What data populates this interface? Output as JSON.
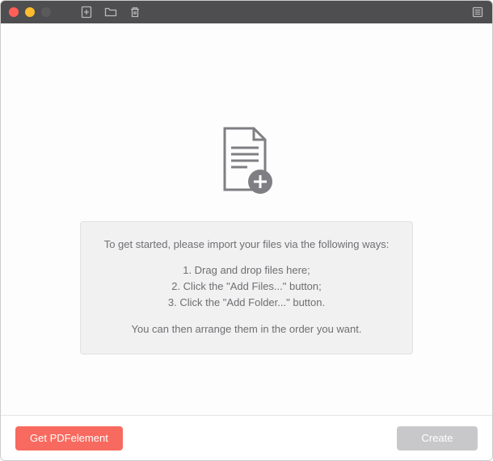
{
  "titlebar": {
    "icons": {
      "add_file": "add-file",
      "add_folder": "add-folder",
      "delete": "delete",
      "list": "list"
    }
  },
  "instructions": {
    "intro": "To get started, please import your files via the following ways:",
    "step1": "1. Drag and drop files here;",
    "step2": "2. Click the \"Add Files...\" button;",
    "step3": "3. Click the \"Add Folder...\" button.",
    "outro": "You can then arrange them in the order you want."
  },
  "footer": {
    "get_label": "Get PDFelement",
    "create_label": "Create"
  }
}
